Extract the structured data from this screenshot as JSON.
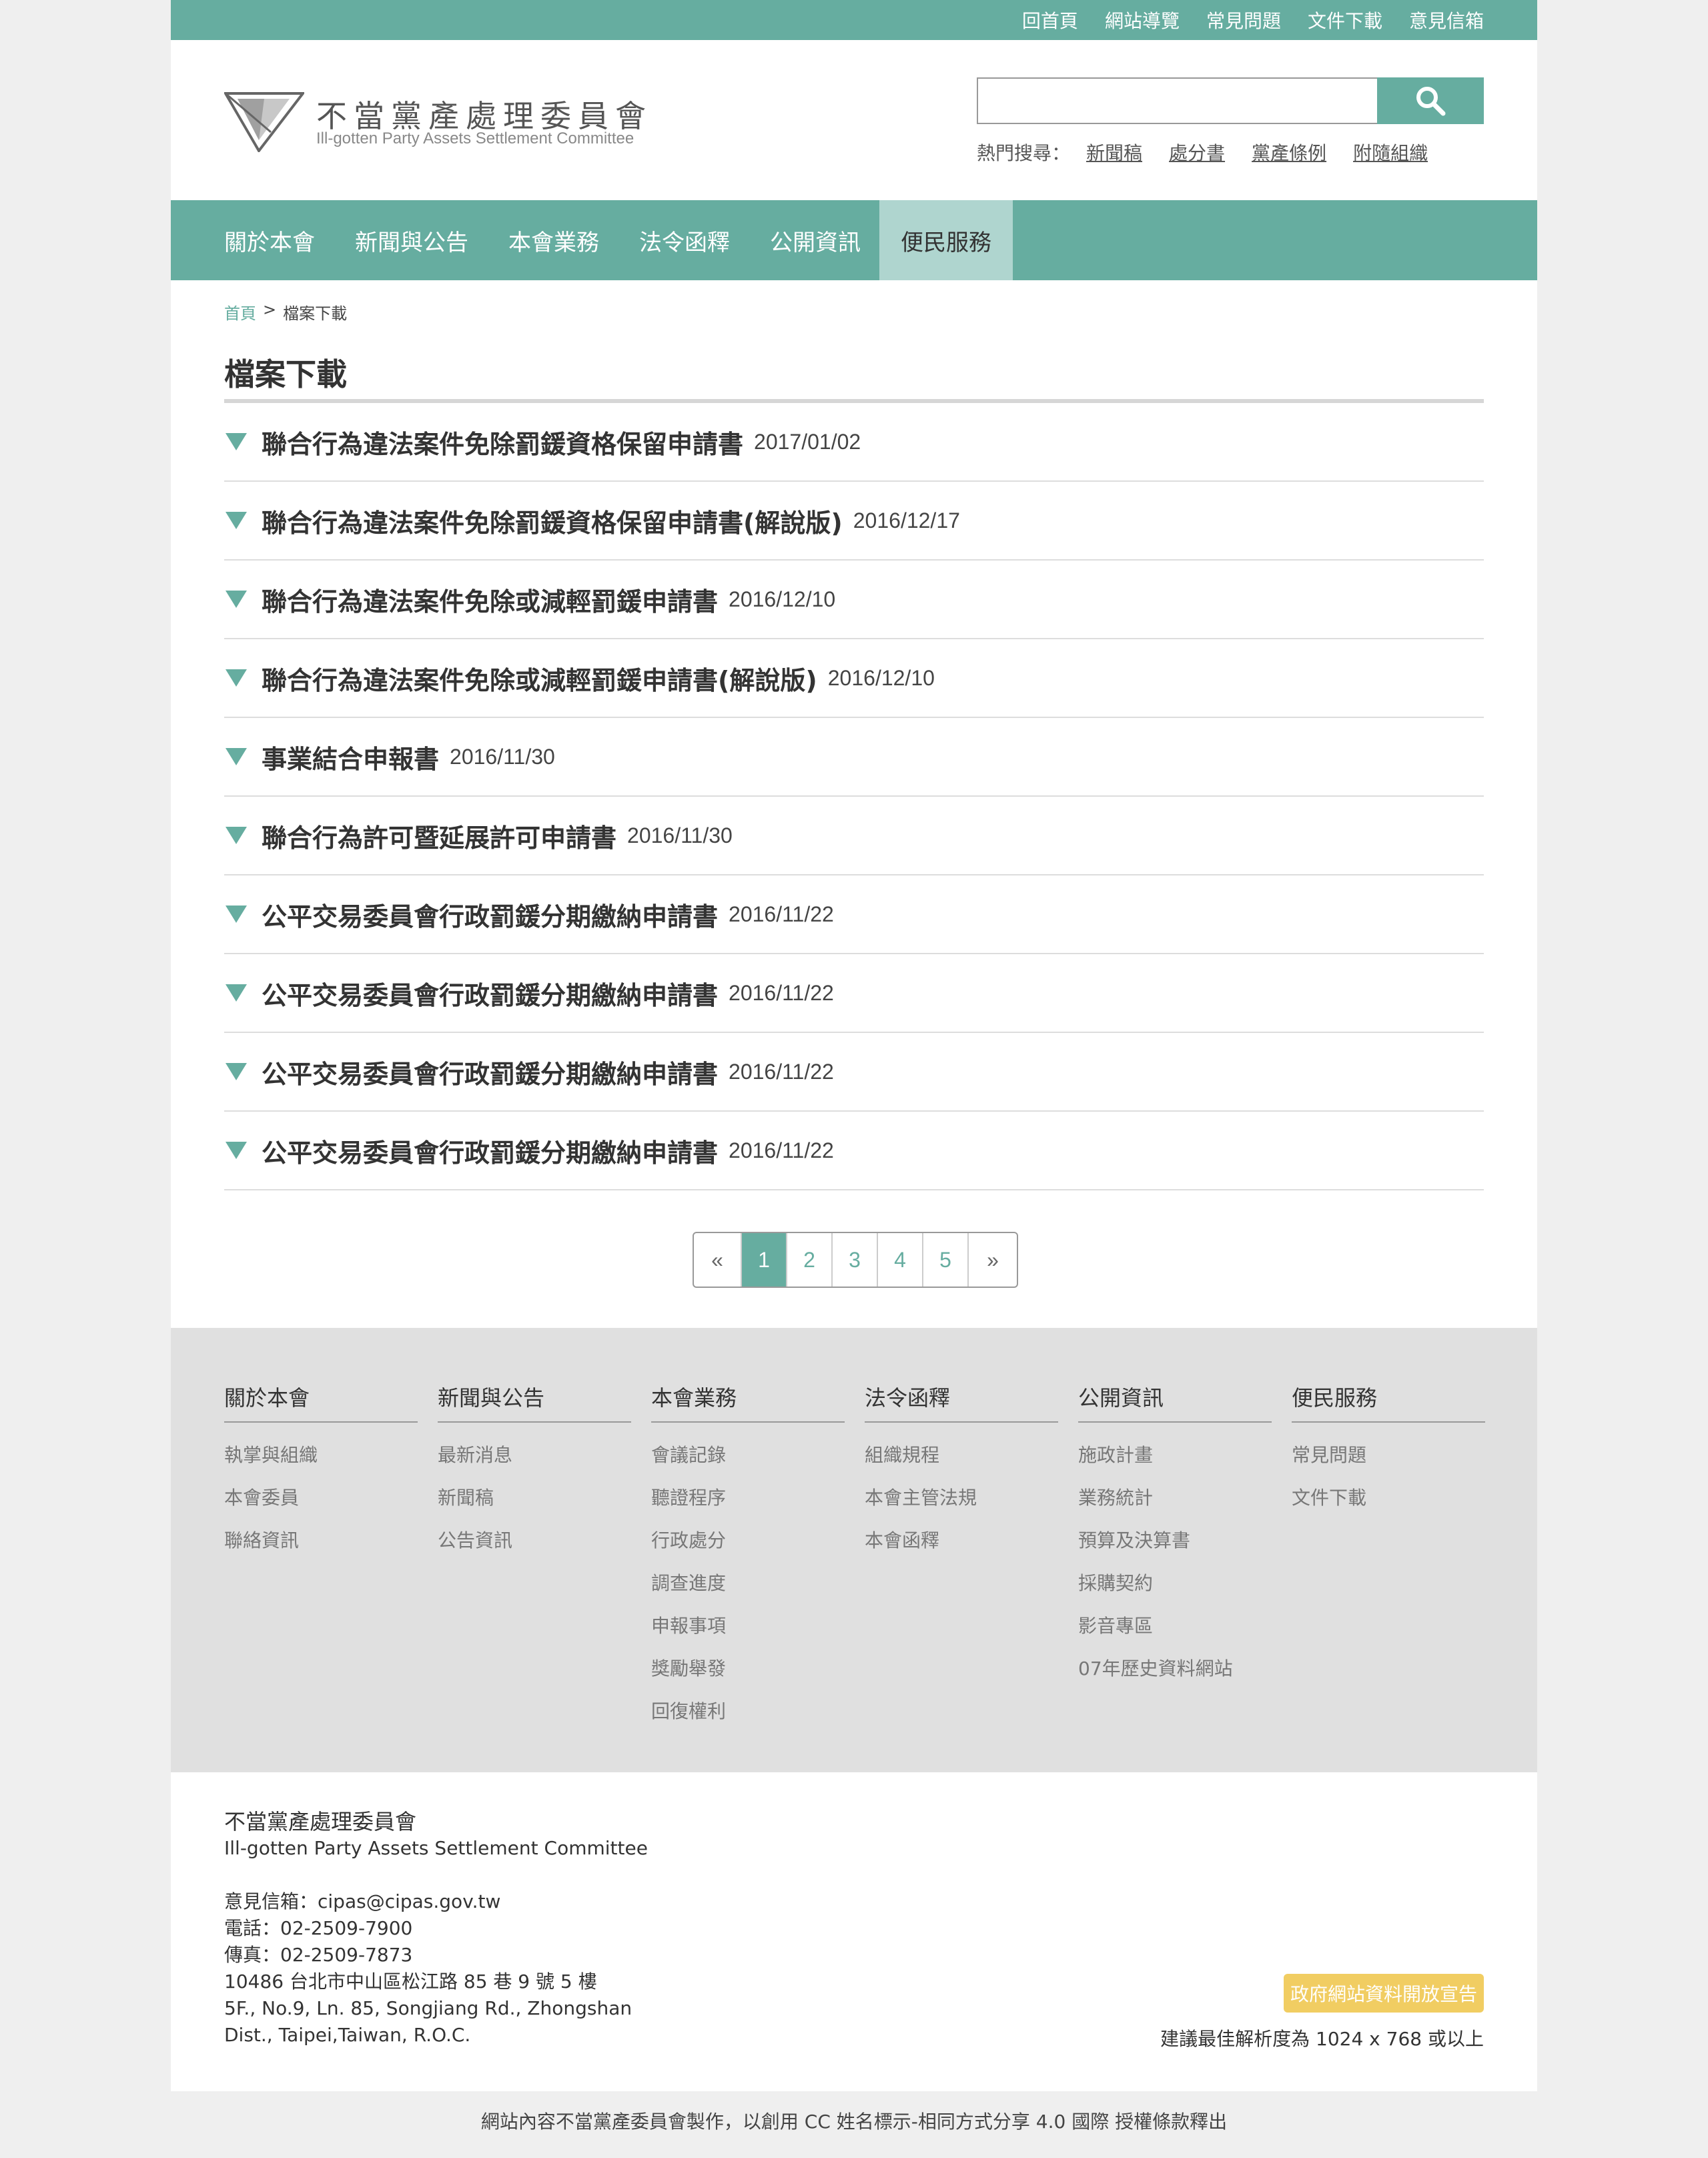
{
  "topbar": {
    "links": [
      "回首頁",
      "網站導覽",
      "常見問題",
      "文件下載",
      "意見信箱"
    ]
  },
  "logo": {
    "zh": "不當黨產處理委員會",
    "en": "Ill-gotten Party Assets Settlement Committee"
  },
  "search": {
    "value": "",
    "hot_label": "熱門搜尋：",
    "hot_links": [
      "新聞稿",
      "處分書",
      "黨產條例",
      "附隨組織"
    ]
  },
  "nav": {
    "items": [
      "關於本會",
      "新聞與公告",
      "本會業務",
      "法令函釋",
      "公開資訊",
      "便民服務"
    ],
    "active": "便民服務"
  },
  "breadcrumb": {
    "home": "首頁",
    "separator": ">",
    "current": "檔案下載"
  },
  "page_title": "檔案下載",
  "files": [
    {
      "name": "聯合行為違法案件免除罰鍰資格保留申請書",
      "date": "2017/01/02"
    },
    {
      "name": "聯合行為違法案件免除罰鍰資格保留申請書(解說版)",
      "date": "2016/12/17"
    },
    {
      "name": "聯合行為違法案件免除或減輕罰鍰申請書",
      "date": "2016/12/10"
    },
    {
      "name": "聯合行為違法案件免除或減輕罰鍰申請書(解說版)",
      "date": "2016/12/10"
    },
    {
      "name": "事業結合申報書",
      "date": "2016/11/30"
    },
    {
      "name": "聯合行為許可暨延展許可申請書",
      "date": "2016/11/30"
    },
    {
      "name": "公平交易委員會行政罰鍰分期繳納申請書",
      "date": "2016/11/22"
    },
    {
      "name": "公平交易委員會行政罰鍰分期繳納申請書",
      "date": "2016/11/22"
    },
    {
      "name": "公平交易委員會行政罰鍰分期繳納申請書",
      "date": "2016/11/22"
    },
    {
      "name": "公平交易委員會行政罰鍰分期繳納申請書",
      "date": "2016/11/22"
    }
  ],
  "pagination": {
    "prev": "«",
    "pages": [
      "1",
      "2",
      "3",
      "4",
      "5"
    ],
    "current": "1",
    "next": "»"
  },
  "sitemap": [
    {
      "title": "關於本會",
      "links": [
        "執掌與組織",
        "本會委員",
        "聯絡資訊"
      ]
    },
    {
      "title": "新聞與公告",
      "links": [
        "最新消息",
        "新聞稿",
        "公告資訊"
      ]
    },
    {
      "title": "本會業務",
      "links": [
        "會議記錄",
        "聽證程序",
        "行政處分",
        "調查進度",
        "申報事項",
        "獎勵舉發",
        "回復權利"
      ]
    },
    {
      "title": "法令函釋",
      "links": [
        "組織規程",
        "本會主管法規",
        "本會函釋"
      ]
    },
    {
      "title": "公開資訊",
      "links": [
        "施政計畫",
        "業務統計",
        "預算及決算書",
        "採購契約",
        "影音專區",
        "07年歷史資料網站"
      ]
    },
    {
      "title": "便民服務",
      "links": [
        "常見問題",
        "文件下載"
      ]
    }
  ],
  "footer": {
    "org_zh": "不當黨產處理委員會",
    "org_en": "Ill-gotten Party Assets Settlement Committee",
    "email": "意見信箱：cipas@cipas.gov.tw",
    "phone": "電話：02-2509-7900",
    "fax": "傳真：02-2509-7873",
    "address_zh": "10486 台北市中山區松江路 85 巷 9 號 5 樓",
    "address_en_1": "5F., No.9, Ln. 85, Songjiang Rd., Zhongshan",
    "address_en_2": "Dist., Taipei,Taiwan, R.O.C.",
    "opendata": "政府網站資料開放宣告",
    "resolution": "建議最佳解析度為 1024 x 768 或以上",
    "copyright": "網站內容不當黨產委員會製作，以創用 CC 姓名標示-相同方式分享 4.0 國際 授權條款釋出"
  },
  "colors": {
    "brand": "#66ada0",
    "nav_active": "#afd5cf",
    "sitemap_bg": "#e0e0e0",
    "opendata_badge": "#f1cd62"
  },
  "icons": {
    "search": "search-icon",
    "list_bullet": "triangle-down-icon",
    "logo_mark": "logo-triangle-icon"
  }
}
